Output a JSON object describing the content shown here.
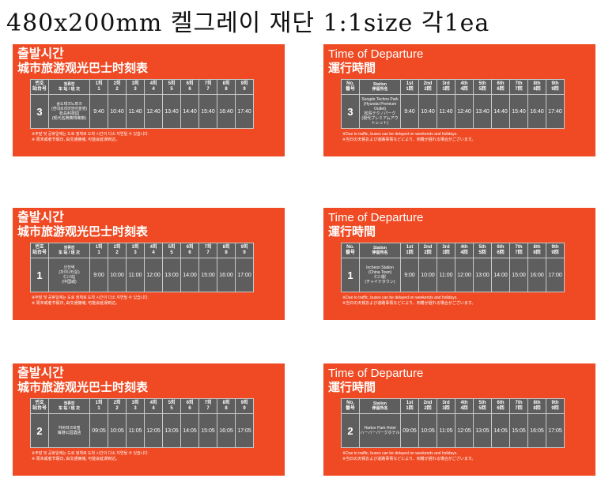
{
  "page_title": "480x200mm 켈그레이 재단 1:1size 각1ea",
  "ko_header": {
    "title": "출발시간",
    "subtitle": "城市旅游观光巴士时刻表",
    "no_l1": "번호",
    "no_l2": "站台号",
    "station_l1": "정류장",
    "station_l2": "车 站 / 班 次",
    "trips": [
      {
        "l1": "1회",
        "l2": "1"
      },
      {
        "l1": "2회",
        "l2": "2"
      },
      {
        "l1": "3회",
        "l2": "3"
      },
      {
        "l1": "4회",
        "l2": "4"
      },
      {
        "l1": "5회",
        "l2": "5"
      },
      {
        "l1": "6회",
        "l2": "6"
      },
      {
        "l1": "7회",
        "l2": "7"
      },
      {
        "l1": "8회",
        "l2": "8"
      },
      {
        "l1": "9회",
        "l2": "9"
      }
    ],
    "note1": "※주말 및 공휴일에는 도로 정체로 도착 시간이 다소 지연될 수 있습니다.",
    "note2": "※ 周末或者节假日, 由交通拥堵, 可能会延误到达。"
  },
  "en_header": {
    "title": "Time of Departure",
    "subtitle": "運行時間",
    "no_l1": "No.",
    "no_l2": "番号",
    "station_l1": "Station",
    "station_l2": "停留所名",
    "trips": [
      {
        "l1": "1st",
        "l2": "1回"
      },
      {
        "l1": "2nd",
        "l2": "2回"
      },
      {
        "l1": "3rd",
        "l2": "3回"
      },
      {
        "l1": "4th",
        "l2": "4回"
      },
      {
        "l1": "5th",
        "l2": "5回"
      },
      {
        "l1": "6th",
        "l2": "6回"
      },
      {
        "l1": "7th",
        "l2": "7回"
      },
      {
        "l1": "8th",
        "l2": "8回"
      },
      {
        "l1": "9th",
        "l2": "9回"
      }
    ],
    "note1": "※Due to traffic, buses can be delayed on weekends and holidays.",
    "note2": "※当日の天候および道路事情などにより、到着が遅れる場合がございます。"
  },
  "panels": [
    {
      "lang": "ko",
      "no": "3",
      "station": [
        "송도테크노파크",
        "(현대프리미엄아울렛)",
        "松岛科技园",
        "(现代名牌奥特莱斯)"
      ],
      "times": [
        "9:40",
        "10:40",
        "11:40",
        "12:40",
        "13:40",
        "14:40",
        "15:40",
        "16:40",
        "17:40"
      ]
    },
    {
      "lang": "en",
      "no": "3",
      "station": [
        "Songdo Techno Park",
        "(Hyundai Premium Outlet)",
        "松島テクノパーク",
        "(現代プレミアムアウトレット)"
      ],
      "times": [
        "9:40",
        "10:40",
        "11:40",
        "12:40",
        "13:40",
        "14:40",
        "15:40",
        "16:40",
        "17:40"
      ]
    },
    {
      "lang": "ko",
      "no": "1",
      "station": [
        "인천역",
        "(차이나타운)",
        "仁川站",
        "(中国城)"
      ],
      "times": [
        "9:00",
        "10:00",
        "11:00",
        "12:00",
        "13:00",
        "14:00",
        "15:00",
        "16:00",
        "17:00"
      ]
    },
    {
      "lang": "en",
      "no": "1",
      "station": [
        "Incheon Station",
        "(China Town)",
        "仁川駅",
        "(チャイナタウン)"
      ],
      "times": [
        "9:00",
        "10:00",
        "11:00",
        "12:00",
        "13:00",
        "14:00",
        "15:00",
        "16:00",
        "17:00"
      ]
    },
    {
      "lang": "ko",
      "no": "2",
      "station": [
        "하버파크호텔",
        "海港公园酒店",
        "",
        ""
      ],
      "times": [
        "09:05",
        "10:05",
        "11:05",
        "12:05",
        "13:05",
        "14:05",
        "15:05",
        "16:05",
        "17:05"
      ]
    },
    {
      "lang": "en",
      "no": "2",
      "station": [
        "Harbor Park Hotel",
        "ハーバーパークホテル",
        "",
        ""
      ],
      "times": [
        "09:05",
        "10:05",
        "11:05",
        "12:05",
        "13:05",
        "14:05",
        "15:05",
        "16:05",
        "17:05"
      ]
    }
  ]
}
